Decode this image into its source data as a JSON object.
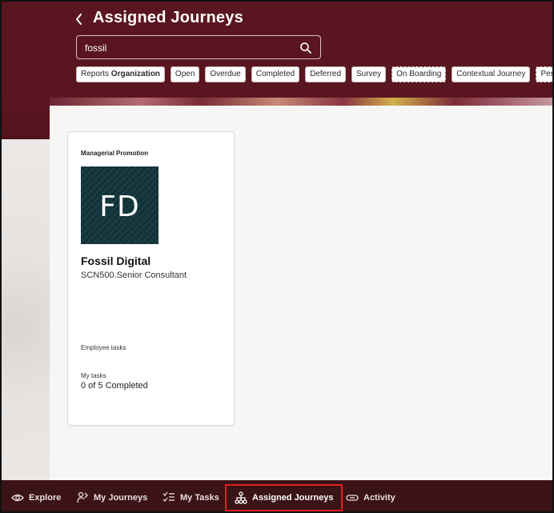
{
  "header": {
    "title": "Assigned Journeys",
    "back_icon": "chevron-left-icon"
  },
  "search": {
    "value": "fossil",
    "placeholder": "",
    "icon": "search-icon"
  },
  "filters": [
    {
      "label_prefix": "Reports",
      "label_bold": "Organization"
    },
    {
      "label": "Open"
    },
    {
      "label": "Overdue"
    },
    {
      "label": "Completed"
    },
    {
      "label": "Deferred"
    },
    {
      "label": "Survey"
    },
    {
      "label": "On Boarding"
    },
    {
      "label": "Contextual Journey"
    },
    {
      "label": "Person"
    }
  ],
  "card": {
    "type": "Managerial Promotion",
    "initials": "FD",
    "name": "Fossil Digital",
    "role": "SCN500.Senior Consultant",
    "employee_tasks_label": "Employee tasks",
    "my_tasks_label": "My tasks",
    "my_tasks_value": "0 of 5 Completed"
  },
  "bottom_nav": [
    {
      "label": "Explore",
      "icon": "eye-icon"
    },
    {
      "label": "My Journeys",
      "icon": "person-route-icon"
    },
    {
      "label": "My Tasks",
      "icon": "checklist-icon"
    },
    {
      "label": "Assigned Journeys",
      "icon": "hierarchy-icon",
      "active": true
    },
    {
      "label": "Activity",
      "icon": "link-icon"
    }
  ],
  "colors": {
    "header_bg": "#5a1620",
    "bottom_bar_bg": "#3b1216",
    "active_outline": "#e02020"
  }
}
